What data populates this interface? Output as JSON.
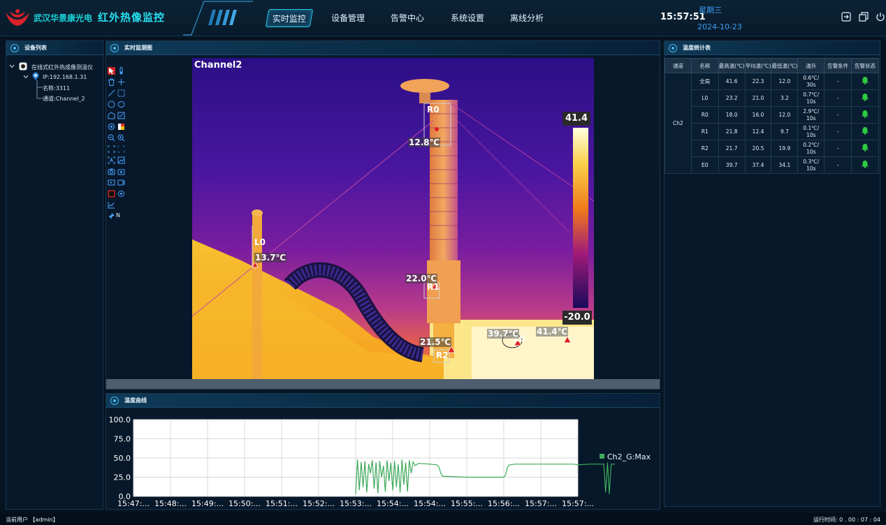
{
  "header": {
    "company": "武汉华景康光电",
    "title": "红外热像监控",
    "nav": [
      "实时监控",
      "设备管理",
      "告警中心",
      "系统设置",
      "离线分析"
    ],
    "active_nav": 0,
    "time": "15:57:51",
    "weekday": "星期三",
    "date": "2024-10-23"
  },
  "device_panel": {
    "title": "设备列表",
    "tree": [
      "在线式红外热成像测温仪",
      "IP:192.168.1.31",
      "名称:3311",
      "通道:Channel_2"
    ]
  },
  "monitor_panel": {
    "title": "实时监测图",
    "channel": "Channel2",
    "scale_max": "41.4",
    "scale_min": "-20.0",
    "toolbar_last_label": "N",
    "regions": [
      {
        "name": "R0",
        "temp": "12.8℃"
      },
      {
        "name": "L0",
        "temp": "13.7℃"
      },
      {
        "name": "R1",
        "temp": "22.0℃"
      },
      {
        "name": "R2",
        "temp": "21.5℃"
      },
      {
        "name": "E0",
        "temp": "39.7℃"
      },
      {
        "name": "",
        "temp": "41.4℃"
      }
    ]
  },
  "stats_panel": {
    "title": "温度统计表",
    "columns": [
      "通道",
      "名称",
      "最高温(℃)",
      "平均温(℃)",
      "最低温(℃)",
      "温升",
      "告警条件",
      "告警状态"
    ],
    "channel": "Ch2",
    "rows": [
      {
        "name": "全局",
        "max": "41.6",
        "avg": "22.3",
        "min": "12.0",
        "rise1": "0.6℃/",
        "rise2": "30s",
        "cond": "-"
      },
      {
        "name": "L0",
        "max": "23.2",
        "avg": "21.0",
        "min": "3.2",
        "rise1": "0.7℃/",
        "rise2": "10s",
        "cond": "-"
      },
      {
        "name": "R0",
        "max": "18.0",
        "avg": "16.0",
        "min": "12.0",
        "rise1": "2.9℃/",
        "rise2": "10s",
        "cond": "-"
      },
      {
        "name": "R1",
        "max": "21.8",
        "avg": "12.4",
        "min": "9.7",
        "rise1": "0.1℃/",
        "rise2": "10s",
        "cond": "-"
      },
      {
        "name": "R2",
        "max": "21.7",
        "avg": "20.5",
        "min": "19.9",
        "rise1": "0.2℃/",
        "rise2": "10s",
        "cond": "-"
      },
      {
        "name": "E0",
        "max": "39.7",
        "avg": "37.4",
        "min": "34.1",
        "rise1": "0.3℃/",
        "rise2": "10s",
        "cond": "-"
      }
    ],
    "alarm_color": "#2ecc40"
  },
  "curve_panel": {
    "title": "温度曲线"
  },
  "chart_data": {
    "type": "line",
    "x": [
      "15:47:...",
      "15:48:...",
      "15:49:...",
      "15:50:...",
      "15:51:...",
      "15:52:...",
      "15:53:...",
      "15:54:...",
      "15:54:...",
      "15:55:...",
      "15:56:...",
      "15:57:...",
      "15:57:..."
    ],
    "yticks": [
      "100.0",
      "75.0",
      "50.0",
      "25.0",
      "0.0"
    ],
    "ylim": [
      0,
      100
    ],
    "series": [
      {
        "name": "Ch2_G:Max",
        "color": "#3daa5a",
        "points": [
          [
            6.0,
            3
          ],
          [
            6.05,
            48
          ],
          [
            6.1,
            8
          ],
          [
            6.15,
            45
          ],
          [
            6.2,
            12
          ],
          [
            6.25,
            46
          ],
          [
            6.3,
            5
          ],
          [
            6.35,
            42
          ],
          [
            6.4,
            30
          ],
          [
            6.45,
            47
          ],
          [
            6.5,
            10
          ],
          [
            6.55,
            44
          ],
          [
            6.6,
            4
          ],
          [
            6.65,
            46
          ],
          [
            6.7,
            25
          ],
          [
            6.75,
            40
          ],
          [
            6.8,
            6
          ],
          [
            6.85,
            47
          ],
          [
            6.9,
            20
          ],
          [
            6.95,
            44
          ],
          [
            7.0,
            8
          ],
          [
            7.05,
            46
          ],
          [
            7.1,
            12
          ],
          [
            7.15,
            42
          ],
          [
            7.2,
            5
          ],
          [
            7.25,
            48
          ],
          [
            7.3,
            15
          ],
          [
            7.35,
            44
          ],
          [
            7.4,
            6
          ],
          [
            7.45,
            47
          ],
          [
            7.5,
            30
          ],
          [
            7.55,
            45
          ],
          [
            7.6,
            40
          ],
          [
            7.7,
            43
          ],
          [
            8.0,
            42
          ],
          [
            8.2,
            41
          ],
          [
            8.25,
            38
          ],
          [
            8.3,
            30
          ],
          [
            8.35,
            26
          ],
          [
            8.5,
            26
          ],
          [
            9.0,
            25
          ],
          [
            9.5,
            25
          ],
          [
            10.0,
            25
          ],
          [
            10.05,
            28
          ],
          [
            10.1,
            38
          ],
          [
            10.15,
            41
          ],
          [
            10.3,
            42
          ],
          [
            11.0,
            42
          ],
          [
            11.5,
            42
          ],
          [
            11.9,
            42
          ],
          [
            12.0,
            41
          ],
          [
            12.3,
            42
          ],
          [
            12.7,
            42
          ],
          [
            12.75,
            5
          ],
          [
            12.8,
            44
          ],
          [
            12.85,
            3
          ],
          [
            12.9,
            42
          ],
          [
            13.0,
            42
          ]
        ]
      }
    ]
  },
  "footer": {
    "user": "当前用户 【admin】",
    "runtime": "运行时间: 0 . 00 : 07 : 04"
  }
}
